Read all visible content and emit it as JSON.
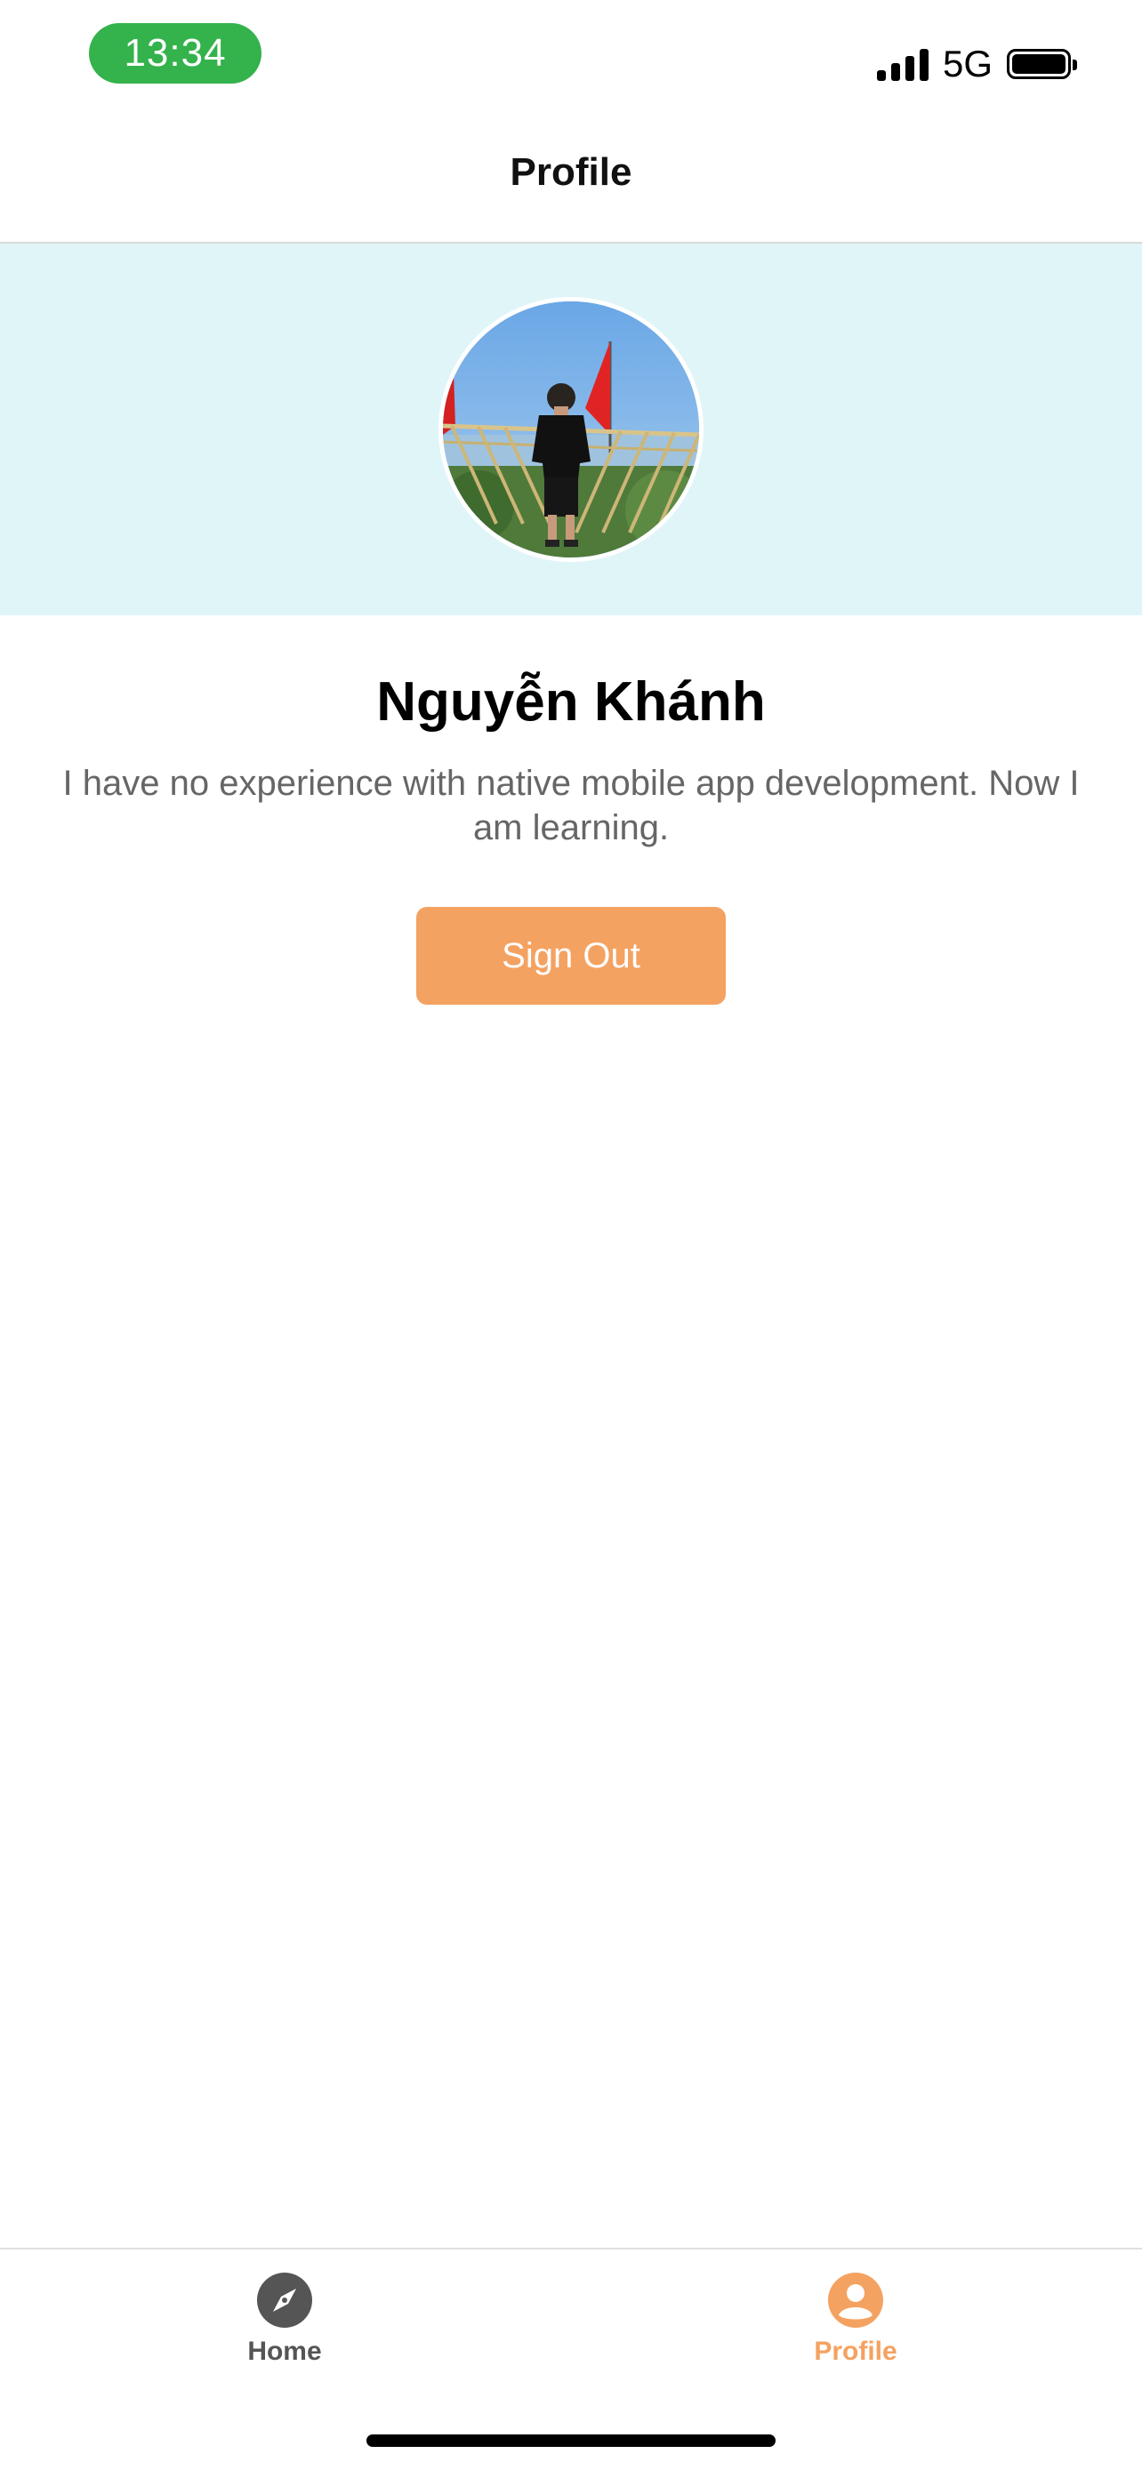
{
  "status_bar": {
    "time": "13:34",
    "network": "5G",
    "icons": [
      "signal-icon",
      "battery-icon"
    ],
    "time_pill_color": "#34b24c"
  },
  "nav": {
    "title": "Profile"
  },
  "profile": {
    "name": "Nguyễn Khánh",
    "bio": "I have no experience with native mobile app development. Now I am learning.",
    "banner_color": "#e0f5f8",
    "avatar_icon": "avatar"
  },
  "actions": {
    "sign_out_label": "Sign Out",
    "accent_color": "#f4a261"
  },
  "tabs": [
    {
      "label": "Home",
      "icon": "compass-icon",
      "active": false
    },
    {
      "label": "Profile",
      "icon": "user-circle-icon",
      "active": true
    }
  ]
}
